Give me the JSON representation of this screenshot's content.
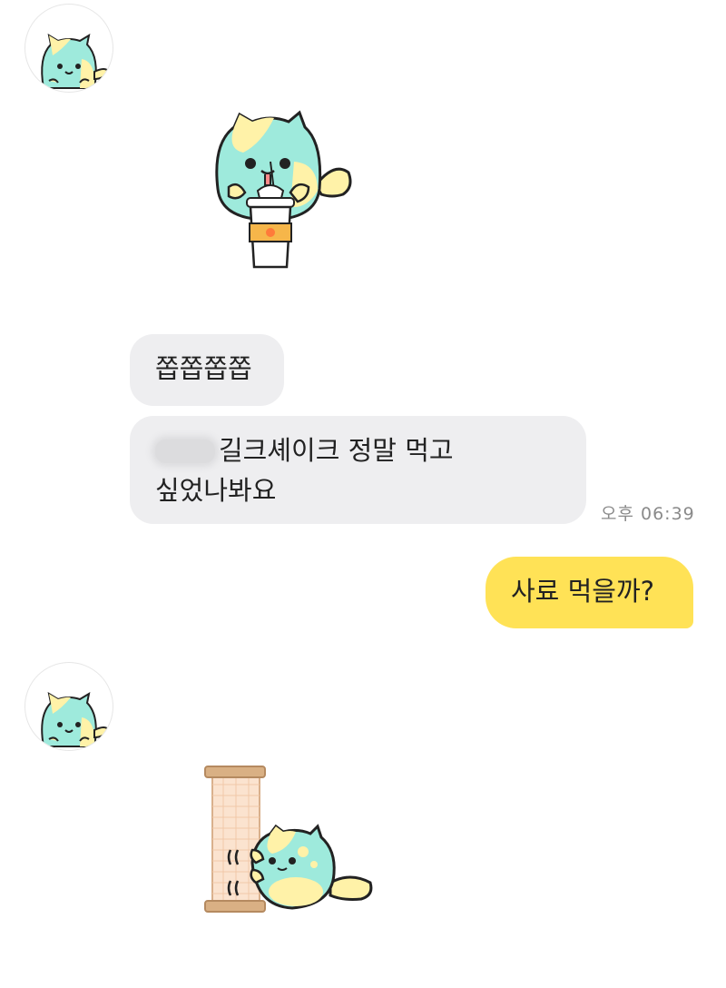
{
  "messages": [
    {
      "type": "sticker",
      "sender": "other",
      "sticker_icon": "cat-drinking-milkshake-sticker"
    },
    {
      "type": "text",
      "sender": "other",
      "text": "쫍쫍쫍쫍"
    },
    {
      "type": "text",
      "sender": "other",
      "text_line1": "길크셰이크 정말 먹고",
      "text_line2": "싶었나봐요",
      "time": "오후 06:39"
    },
    {
      "type": "text",
      "sender": "me",
      "text": "사료 먹을까?"
    },
    {
      "type": "sticker",
      "sender": "other",
      "sticker_icon": "cat-scratching-post-sticker"
    }
  ],
  "avatar_icon": "cat-profile-avatar",
  "colors": {
    "incoming_bubble": "#eeeef0",
    "outgoing_bubble": "#ffe256",
    "background": "#ffffff"
  }
}
